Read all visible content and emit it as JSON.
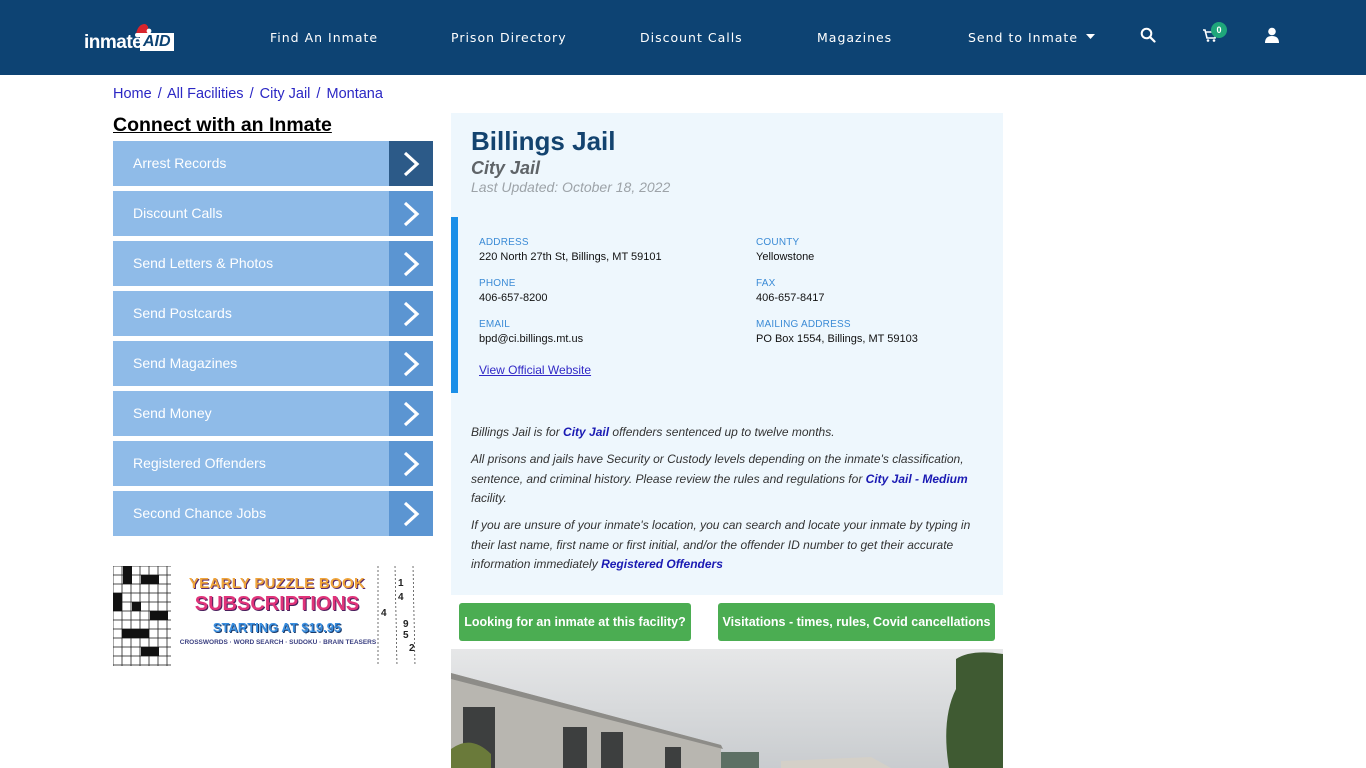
{
  "header": {
    "logo": {
      "left": "inmate",
      "right": "AID"
    },
    "nav": [
      {
        "label": "Find An Inmate"
      },
      {
        "label": "Prison Directory"
      },
      {
        "label": "Discount Calls"
      },
      {
        "label": "Magazines"
      },
      {
        "label": "Send to Inmate",
        "has_dropdown": true
      }
    ],
    "icons": {
      "search": "search-icon",
      "cart": "cart-icon",
      "user": "user-icon"
    },
    "cart_count": "0"
  },
  "breadcrumb": [
    {
      "label": "Home"
    },
    {
      "label": "All Facilities"
    },
    {
      "label": "City Jail"
    },
    {
      "label": "Montana"
    }
  ],
  "breadcrumb_separator": "/",
  "sidebar": {
    "title": "Connect with an Inmate",
    "items": [
      {
        "label": "Arrest Records",
        "active": true
      },
      {
        "label": "Discount Calls"
      },
      {
        "label": "Send Letters & Photos"
      },
      {
        "label": "Send Postcards"
      },
      {
        "label": "Send Magazines"
      },
      {
        "label": "Send Money"
      },
      {
        "label": "Registered Offenders"
      },
      {
        "label": "Second Chance Jobs"
      }
    ],
    "ad": {
      "line1": "YEARLY PUZZLE BOOK",
      "line2": "SUBSCRIPTIONS",
      "line3": "STARTING AT $19.95",
      "line4": "CROSSWORDS · WORD SEARCH · SUDOKU · BRAIN TEASERS",
      "sudoku_digits": [
        "1",
        "4",
        "4",
        "9",
        "5",
        "2"
      ]
    }
  },
  "facility": {
    "name": "Billings Jail",
    "type": "City Jail",
    "last_updated": "Last Updated: October 18, 2022",
    "fields": {
      "address": {
        "label": "ADDRESS",
        "value": "220 North 27th St, Billings, MT 59101"
      },
      "county": {
        "label": "COUNTY",
        "value": "Yellowstone"
      },
      "phone": {
        "label": "PHONE",
        "value": "406-657-8200"
      },
      "fax": {
        "label": "FAX",
        "value": "406-657-8417"
      },
      "email": {
        "label": "EMAIL",
        "value": "bpd@ci.billings.mt.us"
      },
      "mailing": {
        "label": "MAILING ADDRESS",
        "value": "PO Box 1554, Billings, MT 59103"
      }
    },
    "website_link": "View Official Website",
    "description": {
      "p1": {
        "pre": "Billings Jail is for ",
        "link": "City Jail",
        "post": " offenders sentenced up to twelve months."
      },
      "p2": {
        "pre": "All prisons and jails have Security or Custody levels depending on the inmate's classification, sentence, and criminal history. Please review the rules and regulations for ",
        "link": "City Jail - Medium",
        "post": " facility."
      },
      "p3": {
        "pre": "If you are unsure of your inmate's location, you can search and locate your inmate by typing in their last name, first name or first initial, and/or the offender ID number to get their accurate information immediately ",
        "link": "Registered Offenders",
        "post": ""
      }
    },
    "buttons": {
      "find_inmate": "Looking for an inmate at this facility?",
      "visitations": "Visitations - times, rules, Covid cancellations"
    }
  },
  "colors": {
    "nav_bg": "#0d4373",
    "menu_item": "#8fbbe8",
    "menu_arrow": "#5b95d2",
    "menu_arrow_active": "#2c5a88",
    "accent_bar": "#1b8fe8",
    "green_button": "#4bad52",
    "badge": "#1fa67a"
  }
}
